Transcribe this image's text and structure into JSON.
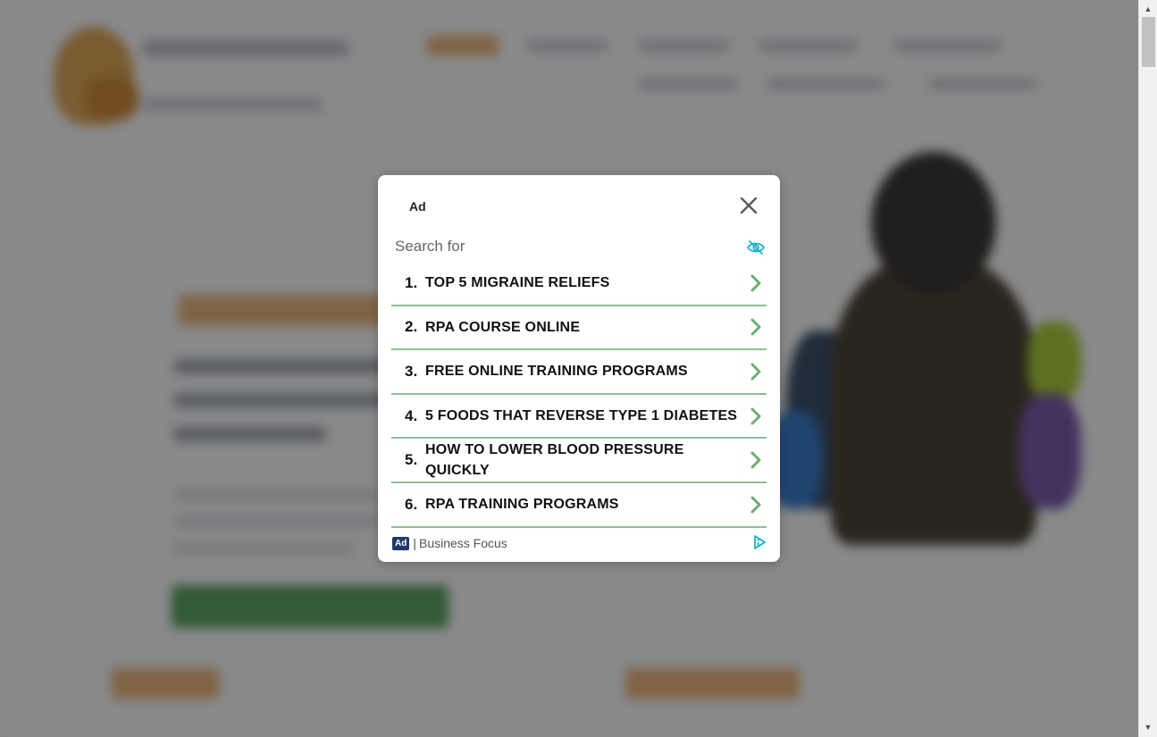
{
  "modal": {
    "ad_label": "Ad",
    "search_label": "Search for",
    "close_icon": "close-icon",
    "visibility_icon": "eye-slash-icon",
    "items": [
      {
        "number": "1.",
        "text": "TOP 5 MIGRAINE RELIEFS"
      },
      {
        "number": "2.",
        "text": "RPA COURSE ONLINE"
      },
      {
        "number": "3.",
        "text": "FREE ONLINE TRAINING PROGRAMS"
      },
      {
        "number": "4.",
        "text": "5 FOODS THAT REVERSE TYPE 1 DIABETES"
      },
      {
        "number": "5.",
        "text": "HOW TO LOWER BLOOD PRESSURE QUICKLY"
      },
      {
        "number": "6.",
        "text": "RPA TRAINING PROGRAMS"
      }
    ],
    "footer": {
      "badge": "Ad",
      "separator": "|",
      "brand": "Business Focus",
      "icon": "adchoices-icon"
    }
  },
  "colors": {
    "accent_teal": "#1ab3c8",
    "divider_green": "#8fc095",
    "chevron_green": "#6cae74",
    "badge_navy": "#1f3a6b"
  }
}
